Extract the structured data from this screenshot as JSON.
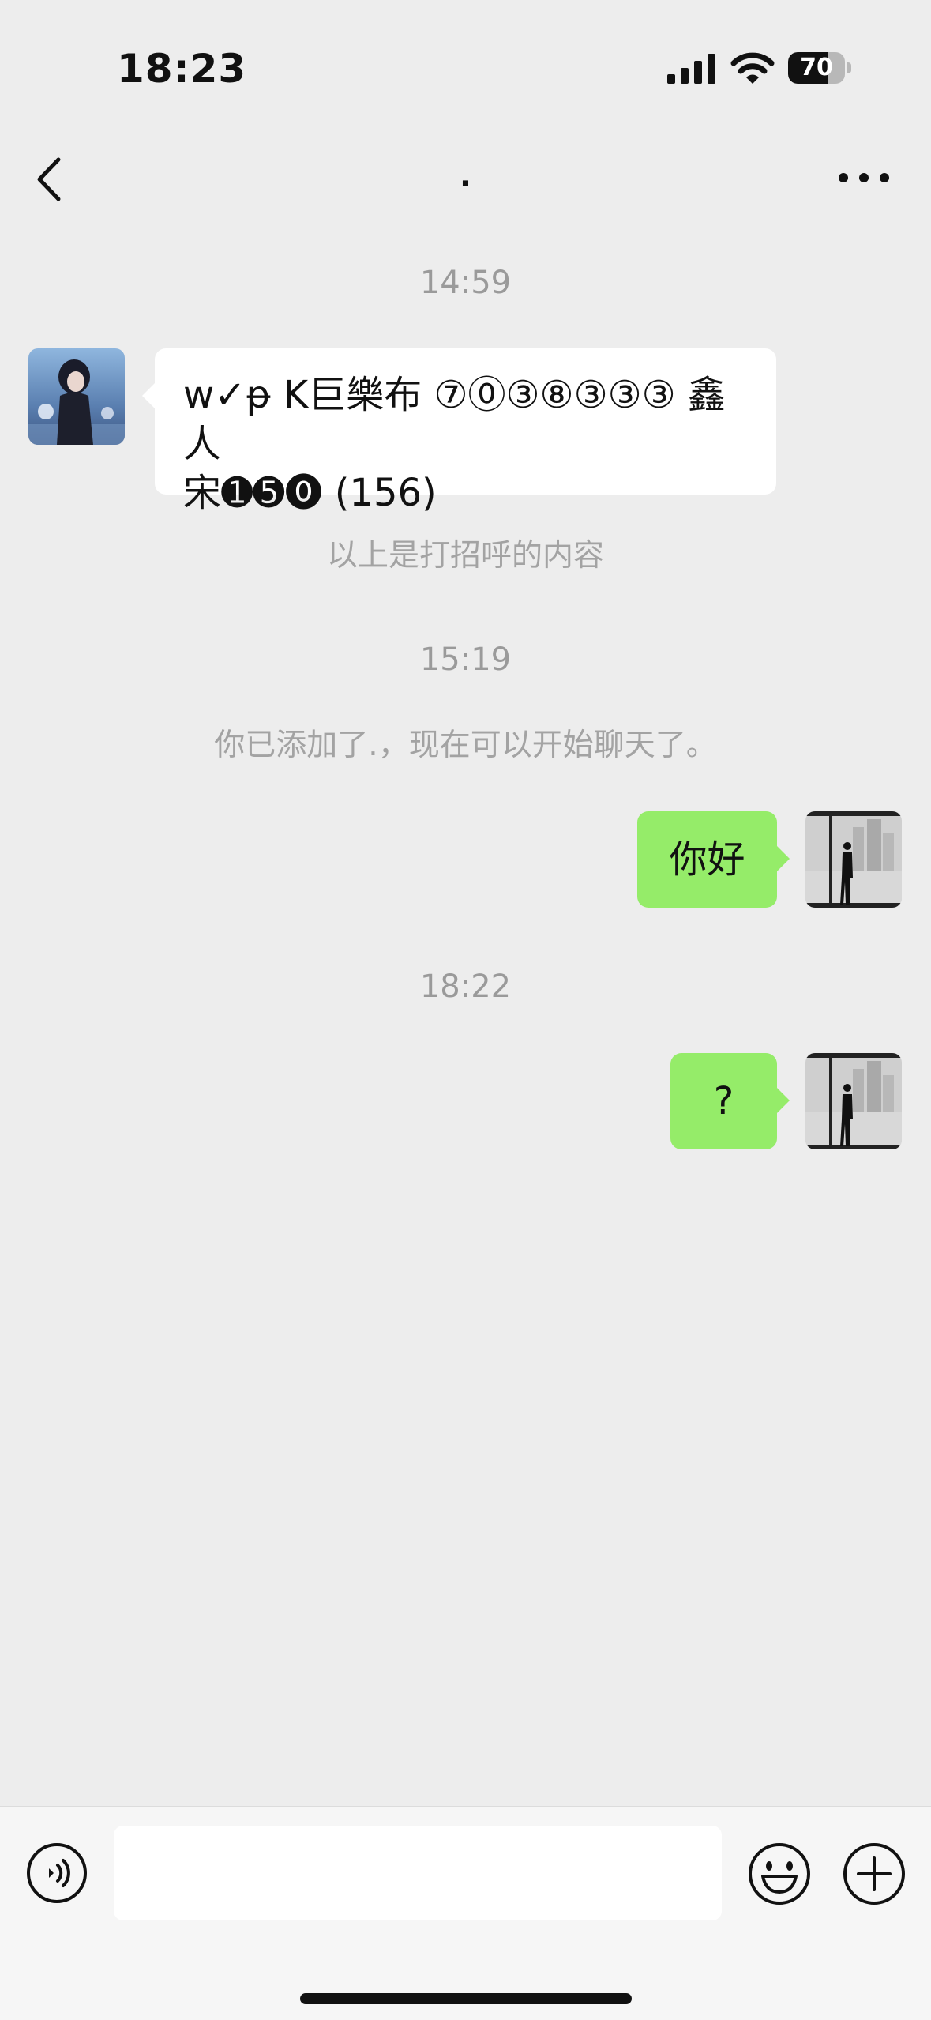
{
  "status_bar": {
    "time": "18:23",
    "battery_level": "70",
    "battery_fraction": 0.7
  },
  "nav": {
    "title": "."
  },
  "messages": {
    "time_1": "14:59",
    "incoming_text_line1": "w✓ᵽ K巨樂布 ⑦⓪③⑧③③③ 鑫人",
    "incoming_text_line2": "宋➊➎⓿ (156)",
    "greeting_note": "以上是打招呼的内容",
    "time_2": "15:19",
    "added_note": "你已添加了.，现在可以开始聊天了。",
    "outgoing_1": "你好",
    "time_3": "18:22",
    "outgoing_2": "?"
  },
  "input": {
    "placeholder": ""
  },
  "icons": {
    "back": "chevron-left-icon",
    "more": "more-dots-icon",
    "voice": "voice-icon",
    "emoji": "emoji-icon",
    "plus": "plus-icon"
  },
  "colors": {
    "background": "#ededed",
    "outgoing_bubble": "#95ec69",
    "incoming_bubble": "#ffffff"
  }
}
